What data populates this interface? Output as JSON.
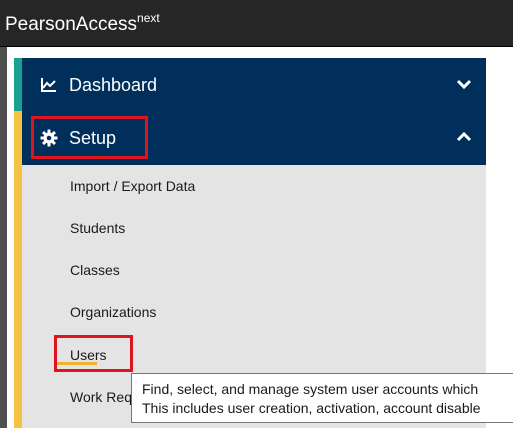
{
  "header": {
    "brand": "PearsonAccess",
    "brand_sup": "next"
  },
  "nav": {
    "dashboard": {
      "label": "Dashboard",
      "icon": "line-chart-icon",
      "chevron": "chevron-down-icon"
    },
    "setup": {
      "label": "Setup",
      "icon": "gear-icon",
      "chevron": "chevron-up-icon"
    },
    "submenu": [
      "Import / Export Data",
      "Students",
      "Classes",
      "Organizations",
      "Users",
      "Work Requests"
    ]
  },
  "tooltip": {
    "line1": "Find, select, and manage system user accounts which",
    "line2": "This includes user creation, activation, account disable"
  },
  "colors": {
    "topbar": "#262626",
    "nav_primary": "#002f5b",
    "accent_teal": "#18a091",
    "accent_yellow": "#f6c244",
    "highlight_red": "#e0141e",
    "underline": "#f0b429"
  }
}
